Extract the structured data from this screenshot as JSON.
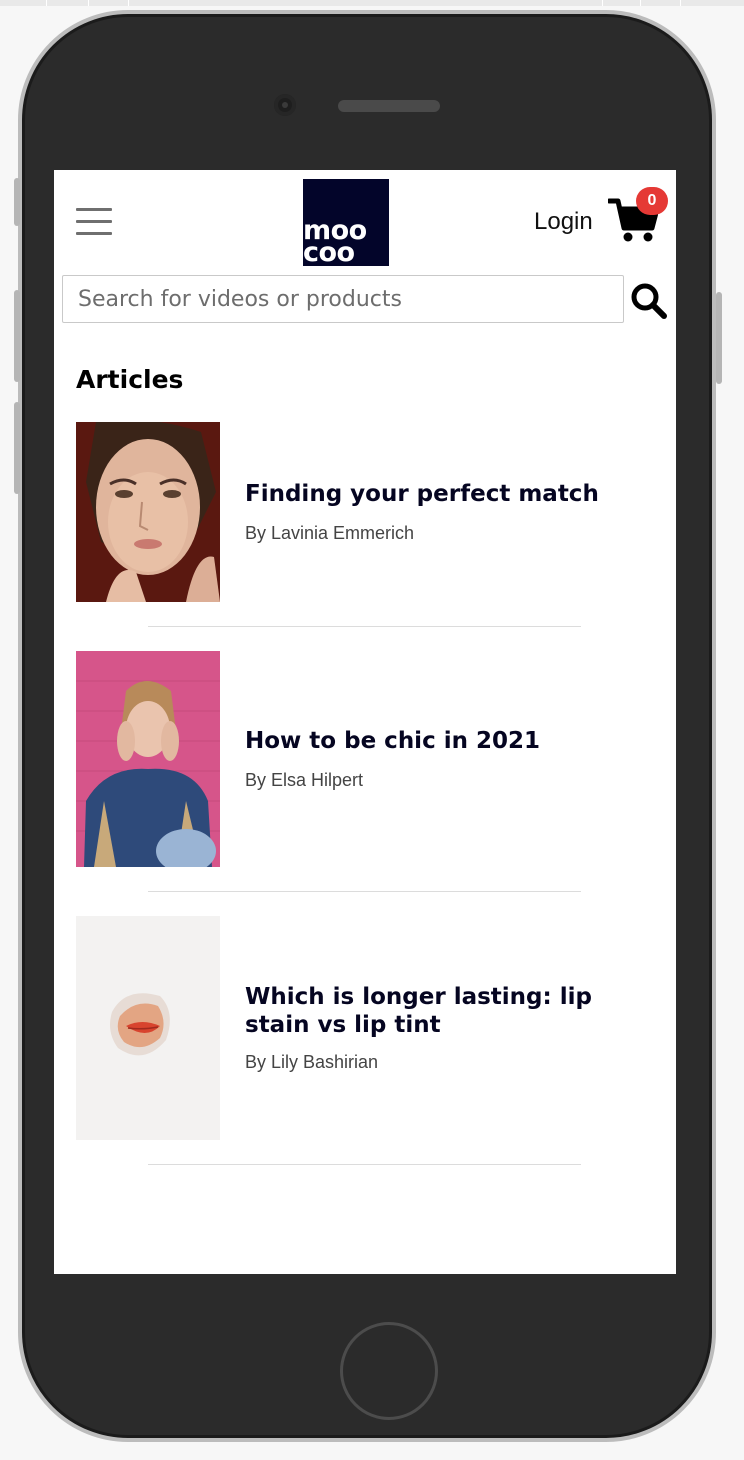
{
  "header": {
    "menu_icon": "hamburger-menu-icon",
    "logo": {
      "line1": "moo",
      "line2": "coo",
      "bg": "#03052a"
    },
    "login_label": "Login",
    "cart_icon": "shopping-cart-icon",
    "cart_count": "0",
    "badge_color": "#e53935"
  },
  "search": {
    "placeholder": "Search for videos or products",
    "value": "",
    "icon": "search-icon"
  },
  "articles_section": {
    "title": "Articles",
    "items": [
      {
        "title": "Finding your perfect match",
        "author": "By Lavinia Emmerich"
      },
      {
        "title": "How to be chic in 2021",
        "author": "By Elsa Hilpert"
      },
      {
        "title": "Which is longer lasting: lip stain vs lip tint",
        "author": "By Lily Bashirian"
      }
    ]
  }
}
